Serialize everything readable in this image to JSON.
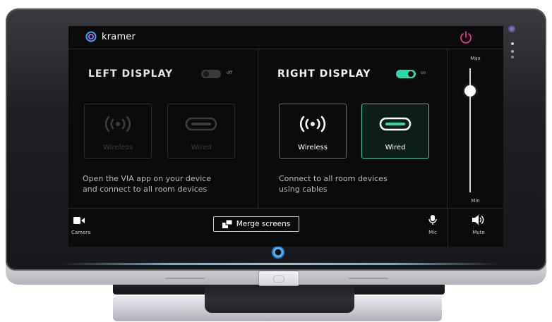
{
  "brand": {
    "name": "kramer",
    "logo_icon": "kramer-logo-icon"
  },
  "left_display": {
    "title": "LEFT DISPLAY",
    "toggle_state": "off",
    "wireless_label": "Wireless",
    "wired_label": "Wired",
    "description_line1": "Open the VIA app on your device",
    "description_line2": "and connect to all room devices"
  },
  "right_display": {
    "title": "RIGHT DISPLAY",
    "toggle_state": "on",
    "wireless_label": "Wireless",
    "wired_label": "Wired",
    "selected_source": "Wired",
    "description_line1": "Connect to all room devices",
    "description_line2": "using cables"
  },
  "volume": {
    "max_label": "Max",
    "min_label": "Min",
    "level": 0.82
  },
  "bottom_bar": {
    "camera_label": "Camera",
    "merge_label": "Merge screens",
    "mic_label": "Mic",
    "mute_label": "Mute"
  },
  "colors": {
    "accent": "#2fd8a8",
    "power": "#e0367f",
    "screen_bg": "#0b0b0c"
  }
}
